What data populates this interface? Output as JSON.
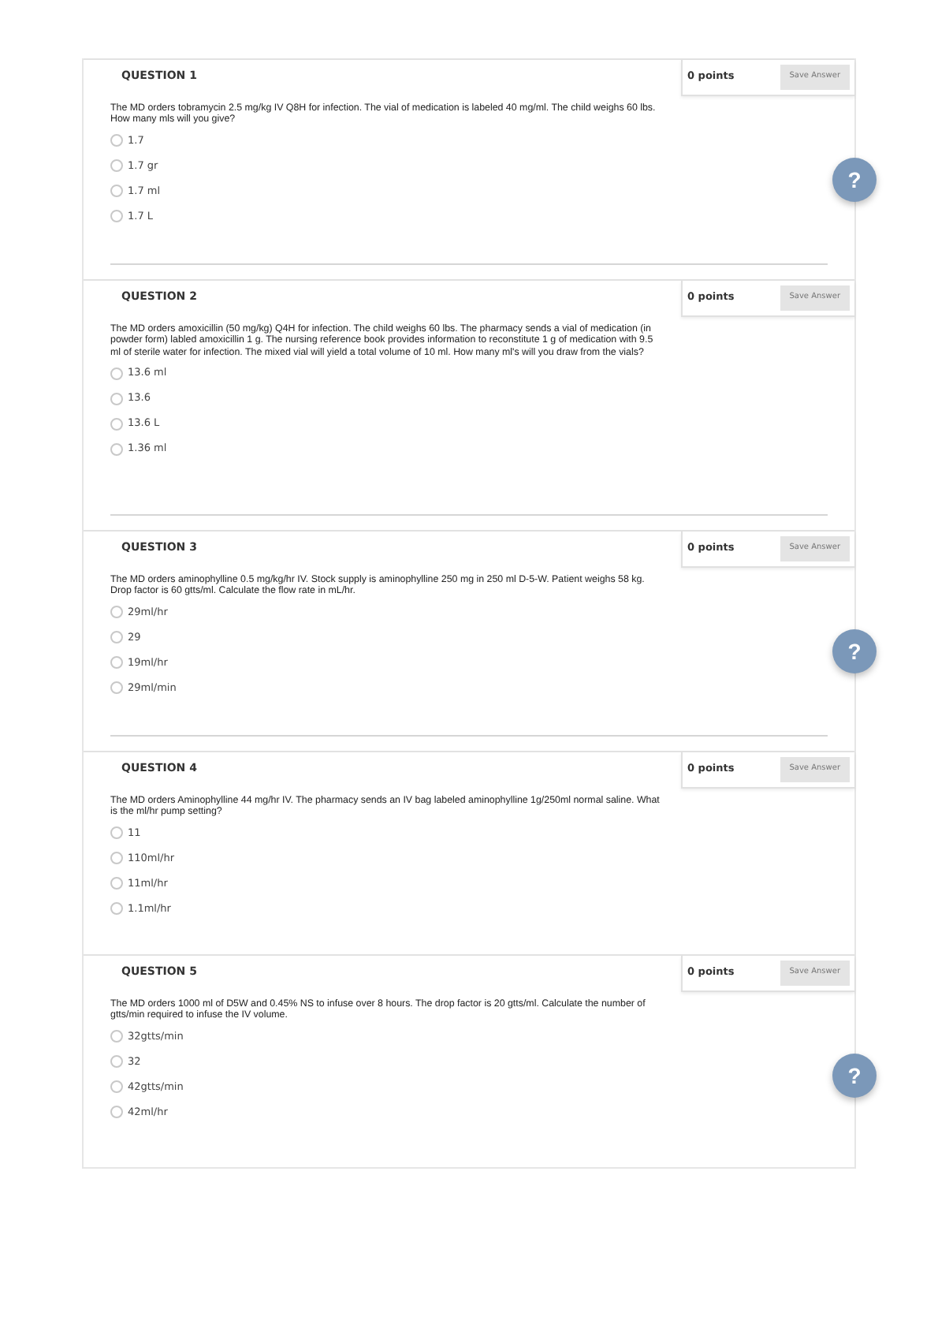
{
  "questions": [
    {
      "title": "QUESTION 1",
      "points": "0 points",
      "save": "Save Answer",
      "text": "The MD orders tobramycin 2.5 mg/kg IV Q8H for infection. The vial of medication is labeled 40 mg/ml. The child weighs 60 lbs. How many mls will you give?",
      "options": [
        {
          "label": "1.7",
          "selected": false
        },
        {
          "label": "1.7 gr",
          "selected": false
        },
        {
          "label": "1.7 ml",
          "selected": false
        },
        {
          "label": "1.7 L",
          "selected": false
        }
      ],
      "divider": true,
      "help": "?"
    },
    {
      "title": "QUESTION 2",
      "points": "0 points",
      "save": "Save Answer",
      "text": "The MD orders amoxicillin (50 mg/kg) Q4H for infection. The child weighs 60 lbs. The pharmacy sends a vial of medication (in powder form) labled amoxicillin 1 g. The nursing reference book provides information to reconstitute 1 g of medication with 9.5 ml of sterile water for infection. The mixed vial will yield a total volume of 10 ml. How many ml's will you draw from the vials?",
      "options": [
        {
          "label": "13.6 ml",
          "selected": false
        },
        {
          "label": "13.6",
          "selected": false
        },
        {
          "label": "13.6 L",
          "selected": false
        },
        {
          "label": "1.36 ml",
          "selected": false
        }
      ],
      "divider": true
    },
    {
      "title": "QUESTION 3",
      "points": "0 points",
      "save": "Save Answer",
      "text": "The MD orders aminophylline 0.5 mg/kg/hr IV. Stock supply is aminophylline 250 mg in 250 ml D-5-W. Patient weighs 58 kg. Drop factor is 60 gtts/ml. Calculate the flow rate in mL/hr.",
      "options": [
        {
          "label": "29ml/hr",
          "selected": false
        },
        {
          "label": "29",
          "selected": false
        },
        {
          "label": "19ml/hr",
          "selected": false
        },
        {
          "label": "29ml/min",
          "selected": false
        }
      ],
      "divider": true,
      "help": "?"
    },
    {
      "title": "QUESTION 4",
      "points": "0 points",
      "save": "Save Answer",
      "text": "The MD orders Aminophylline 44 mg/hr IV. The pharmacy sends an IV bag labeled aminophylline 1g/250ml normal saline. What is the ml/hr pump setting?",
      "options": [
        {
          "label": "11",
          "selected": false
        },
        {
          "label": "110ml/hr",
          "selected": false
        },
        {
          "label": "11ml/hr",
          "selected": false
        },
        {
          "label": "1.1ml/hr",
          "selected": false
        }
      ],
      "divider": false
    },
    {
      "title": "QUESTION 5",
      "points": "0 points",
      "save": "Save Answer",
      "text": "The MD orders 1000 ml of D5W and 0.45% NS to infuse over 8 hours. The drop factor is 20 gtts/ml. Calculate the number of gtts/min required to infuse the IV volume.",
      "options": [
        {
          "label": "32gtts/min",
          "selected": false
        },
        {
          "label": "32",
          "selected": false
        },
        {
          "label": "42gtts/min",
          "selected": false
        },
        {
          "label": "42ml/hr",
          "selected": false
        }
      ],
      "divider": false,
      "help": "?"
    }
  ]
}
